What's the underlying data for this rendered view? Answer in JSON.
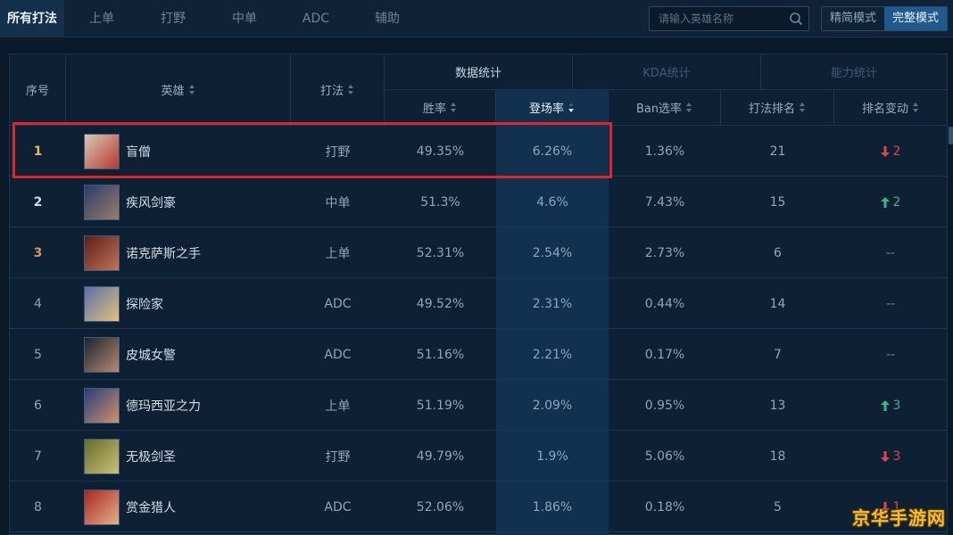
{
  "nav": {
    "tabs": [
      "所有打法",
      "上单",
      "打野",
      "中单",
      "ADC",
      "辅助"
    ],
    "active_tab": 0,
    "search_placeholder": "请输入英雄名称",
    "modes": [
      "精简模式",
      "完整模式"
    ],
    "active_mode": 1
  },
  "table": {
    "headers": {
      "rank": "序号",
      "hero": "英雄",
      "role": "打法",
      "group_data": "数据统计",
      "group_kda": "KDA统计",
      "group_ability": "能力统计",
      "win_rate": "胜率",
      "pick_rate": "登场率",
      "ban_rate": "Ban选率",
      "role_rank": "打法排名",
      "rank_change": "排名变动"
    },
    "rows": [
      {
        "rank": "1",
        "hero": "盲僧",
        "role": "打野",
        "win_rate": "49.35%",
        "pick_rate": "6.26%",
        "ban_rate": "1.36%",
        "role_rank": "21",
        "change_dir": "down",
        "change": "2",
        "avatar_colors": [
          "#d9c7b6",
          "#b33a2f"
        ]
      },
      {
        "rank": "2",
        "hero": "疾风剑豪",
        "role": "中单",
        "win_rate": "51.3%",
        "pick_rate": "4.6%",
        "ban_rate": "7.43%",
        "role_rank": "15",
        "change_dir": "up",
        "change": "2",
        "avatar_colors": [
          "#2b3b6b",
          "#9a7d6a"
        ]
      },
      {
        "rank": "3",
        "hero": "诺克萨斯之手",
        "role": "上单",
        "win_rate": "52.31%",
        "pick_rate": "2.54%",
        "ban_rate": "2.73%",
        "role_rank": "6",
        "change_dir": "none",
        "change": "--",
        "avatar_colors": [
          "#5a1f1a",
          "#c2745a"
        ]
      },
      {
        "rank": "4",
        "hero": "探险家",
        "role": "ADC",
        "win_rate": "49.52%",
        "pick_rate": "2.31%",
        "ban_rate": "0.44%",
        "role_rank": "14",
        "change_dir": "none",
        "change": "--",
        "avatar_colors": [
          "#5a6fa8",
          "#e3c27a"
        ]
      },
      {
        "rank": "5",
        "hero": "皮城女警",
        "role": "ADC",
        "win_rate": "51.16%",
        "pick_rate": "2.21%",
        "ban_rate": "0.17%",
        "role_rank": "7",
        "change_dir": "none",
        "change": "--",
        "avatar_colors": [
          "#1d2430",
          "#b88a74"
        ]
      },
      {
        "rank": "6",
        "hero": "德玛西亚之力",
        "role": "上单",
        "win_rate": "51.19%",
        "pick_rate": "2.09%",
        "ban_rate": "0.95%",
        "role_rank": "13",
        "change_dir": "up",
        "change": "3",
        "avatar_colors": [
          "#263d7a",
          "#d0936a"
        ]
      },
      {
        "rank": "7",
        "hero": "无极剑圣",
        "role": "打野",
        "win_rate": "49.79%",
        "pick_rate": "1.9%",
        "ban_rate": "5.06%",
        "role_rank": "18",
        "change_dir": "down",
        "change": "3",
        "avatar_colors": [
          "#6b6a2a",
          "#c7c27a"
        ]
      },
      {
        "rank": "8",
        "hero": "赏金猎人",
        "role": "ADC",
        "win_rate": "52.06%",
        "pick_rate": "1.86%",
        "ban_rate": "0.18%",
        "role_rank": "5",
        "change_dir": "down",
        "change": "1",
        "avatar_colors": [
          "#a8271f",
          "#e6b08a"
        ]
      }
    ]
  },
  "watermark": "京华手游网",
  "colors": {
    "background": "#0b1a2b",
    "accent": "#1f5a8c",
    "highlight": "#e0242a",
    "up": "#34b98a",
    "down": "#e0474d"
  }
}
